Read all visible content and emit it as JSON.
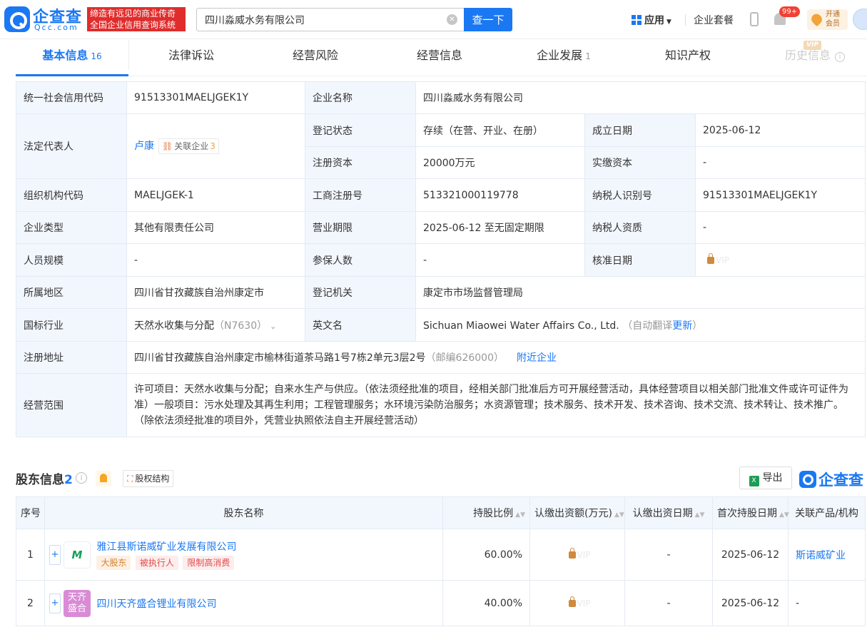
{
  "header": {
    "logo_cn": "企查查",
    "logo_en": "Qcc.com",
    "slogan_line1": "缔造有远见的商业传奇",
    "slogan_line2": "全国企业信用查询系统",
    "search_value": "四川淼威水务有限公司",
    "search_button": "查一下",
    "apps_label": "应用",
    "package_label": "企业套餐",
    "notif_badge": "99+",
    "vip_line1": "开通",
    "vip_line2": "会员"
  },
  "tabs": [
    {
      "label": "基本信息",
      "count": "16"
    },
    {
      "label": "法律诉讼",
      "count": ""
    },
    {
      "label": "经营风险",
      "count": ""
    },
    {
      "label": "经营信息",
      "count": ""
    },
    {
      "label": "企业发展",
      "count": "1"
    },
    {
      "label": "知识产权",
      "count": ""
    },
    {
      "label": "历史信息",
      "count": ""
    }
  ],
  "vip_tag": "VIP",
  "info": {
    "credit_code_label": "统一社会信用代码",
    "credit_code": "91513301MAELJGEK1Y",
    "company_name_label": "企业名称",
    "company_name": "四川淼威水务有限公司",
    "legal_rep_label": "法定代表人",
    "legal_rep": "卢康",
    "related_label": "关联企业",
    "related_count": "3",
    "reg_status_label": "登记状态",
    "reg_status": "存续（在营、开业、在册）",
    "found_date_label": "成立日期",
    "found_date": "2025-06-12",
    "reg_capital_label": "注册资本",
    "reg_capital": "20000万元",
    "paid_capital_label": "实缴资本",
    "paid_capital": "-",
    "org_code_label": "组织机构代码",
    "org_code": "MAELJGEK-1",
    "biz_reg_no_label": "工商注册号",
    "biz_reg_no": "513321000119778",
    "taxpayer_id_label": "纳税人识别号",
    "taxpayer_id": "91513301MAELJGEK1Y",
    "company_type_label": "企业类型",
    "company_type": "其他有限责任公司",
    "biz_term_label": "营业期限",
    "biz_term": "2025-06-12 至无固定期限",
    "taxpayer_qual_label": "纳税人资质",
    "taxpayer_qual": "-",
    "staff_size_label": "人员规模",
    "staff_size": "-",
    "insured_label": "参保人数",
    "insured": "-",
    "approve_date_label": "核准日期",
    "approve_date_vip": "VIP",
    "region_label": "所属地区",
    "region": "四川省甘孜藏族自治州康定市",
    "reg_authority_label": "登记机关",
    "reg_authority": "康定市市场监督管理局",
    "industry_label": "国标行业",
    "industry": "天然水收集与分配",
    "industry_code": "（N7630）",
    "english_name_label": "英文名",
    "english_name": "Sichuan Miaowei Water Affairs Co., Ltd.",
    "auto_translate": "（自动翻译",
    "update_link": "更新",
    "close_paren": "）",
    "address_label": "注册地址",
    "address": "四川省甘孜藏族自治州康定市榆林街道茶马路1号7栋2单元3层2号",
    "postcode": "（邮编626000）",
    "nearby_link": "附近企业",
    "scope_label": "经营范围",
    "scope": "许可项目：天然水收集与分配；自来水生产与供应。（依法须经批准的项目，经相关部门批准后方可开展经营活动，具体经营项目以相关部门批准文件或许可证件为准）一般项目：污水处理及其再生利用；工程管理服务；水环境污染防治服务；水资源管理；技术服务、技术开发、技术咨询、技术交流、技术转让、技术推广。（除依法须经批准的项目外，凭营业执照依法自主开展经营活动）"
  },
  "shareholders": {
    "title": "股东信息",
    "count": "2",
    "equity_button": "股权结构",
    "export_button": "导出",
    "brand": "企查查",
    "columns": [
      "序号",
      "股东名称",
      "持股比例",
      "认缴出资额(万元)",
      "认缴出资日期",
      "首次持股日期",
      "关联产品/机构"
    ],
    "rows": [
      {
        "no": "1",
        "name": "雅江县斯诺威矿业发展有限公司",
        "logo_text": "M",
        "tags": [
          "大股东",
          "被执行人",
          "限制高消费"
        ],
        "ratio": "60.00%",
        "amount_vip": "VIP",
        "sub_date": "-",
        "first_date": "2025-06-12",
        "related": "斯诺威矿业"
      },
      {
        "no": "2",
        "name": "四川天齐盛合锂业有限公司",
        "logo_text": "天齐盛合",
        "tags": [],
        "ratio": "40.00%",
        "amount_vip": "VIP",
        "sub_date": "-",
        "first_date": "2025-06-12",
        "related": "-"
      }
    ]
  }
}
